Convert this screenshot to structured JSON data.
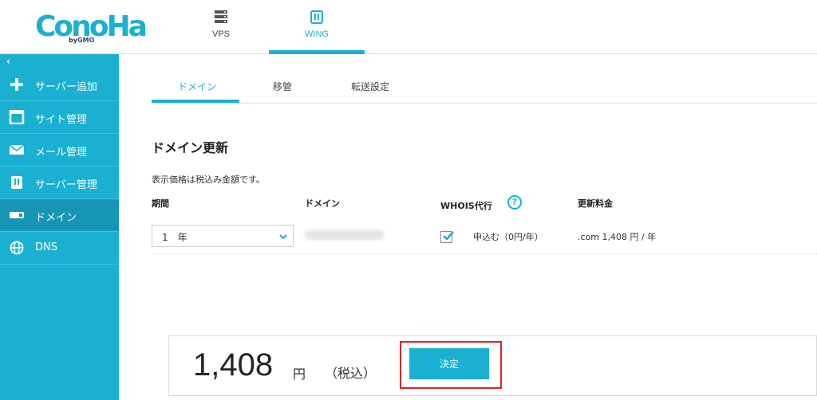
{
  "header": {
    "logo": "ConoHa",
    "logo_sub_by": "by",
    "logo_sub_brand": "GMO",
    "tabs": [
      {
        "label": "VPS",
        "icon": "server-icon"
      },
      {
        "label": "WING",
        "icon": "wing-icon",
        "active": true
      }
    ]
  },
  "sidebar": {
    "collapse_glyph": "‹",
    "items": [
      {
        "label": "サーバー追加",
        "icon": "plus-icon"
      },
      {
        "label": "サイト管理",
        "icon": "window-icon"
      },
      {
        "label": "メール管理",
        "icon": "mail-icon"
      },
      {
        "label": "サーバー管理",
        "icon": "server-manage-icon"
      },
      {
        "label": "ドメイン",
        "icon": "domain-icon",
        "active": true
      },
      {
        "label": "DNS",
        "icon": "globe-icon"
      }
    ]
  },
  "subtabs": [
    {
      "label": "ドメイン",
      "active": true
    },
    {
      "label": "移管"
    },
    {
      "label": "転送設定"
    }
  ],
  "page": {
    "title": "ドメイン更新",
    "tax_note": "表示価格は税込み金額です。",
    "columns": {
      "period": "期間",
      "domain": "ドメイン",
      "whois": "WHOIS代行",
      "fee": "更新料金"
    },
    "help_glyph": "?",
    "row": {
      "period_value": "1　年",
      "whois_checked": true,
      "whois_label": "申込む（0円/年）",
      "fee": ".com 1,408 円 / 年"
    }
  },
  "total": {
    "amount": "1,408",
    "unit": "円",
    "tax": "（税込）",
    "button_label": "決定"
  },
  "colors": {
    "accent": "#1ab0d2",
    "sidebar_active": "#1596b4",
    "highlight": "#d8232a"
  }
}
